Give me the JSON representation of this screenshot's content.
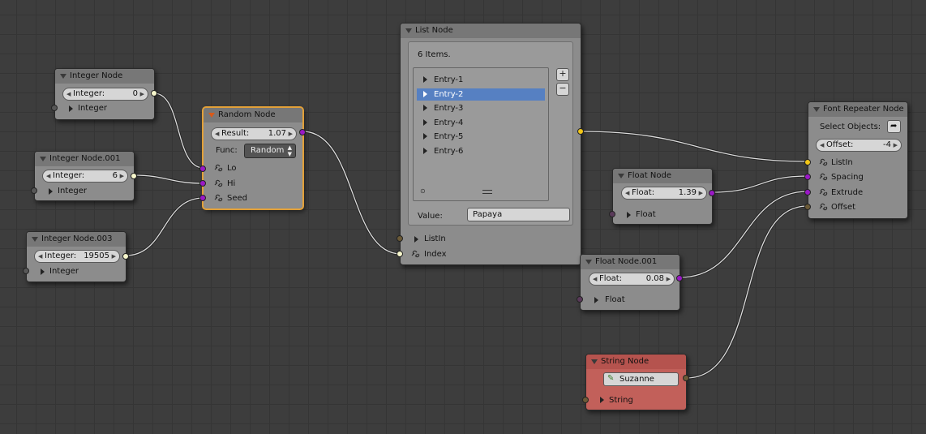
{
  "colors": {
    "background": "#3d3d3d",
    "node": "#8c8c8c",
    "node_header": "#777777",
    "selected_outline": "#e2a038",
    "list_selection": "#5680c2",
    "string_node": "#c2605a"
  },
  "integer_node": {
    "title": "Integer Node",
    "field_label": "Integer:",
    "field_value": "0",
    "output": "Integer"
  },
  "integer_node_001": {
    "title": "Integer Node.001",
    "field_label": "Integer:",
    "field_value": "6",
    "output": "Integer"
  },
  "integer_node_003": {
    "title": "Integer Node.003",
    "field_label": "Integer:",
    "field_value": "19505",
    "output": "Integer"
  },
  "random_node": {
    "title": "Random Node",
    "result_label": "Result:",
    "result_value": "1.07",
    "func_label": "Func:",
    "func_value": "Random",
    "inputs": [
      "Lo",
      "Hi",
      "Seed"
    ]
  },
  "list_node": {
    "title": "List Node",
    "count_text": "6 Items.",
    "entries": [
      "Entry-1",
      "Entry-2",
      "Entry-3",
      "Entry-4",
      "Entry-5",
      "Entry-6"
    ],
    "selected_entry": "Entry-2",
    "value_label": "Value:",
    "value": "Papaya",
    "inputs": [
      "ListIn",
      "Index"
    ],
    "add_icon": "+",
    "remove_icon": "−"
  },
  "float_node": {
    "title": "Float Node",
    "field_label": "Float:",
    "field_value": "1.39",
    "output": "Float"
  },
  "float_node_001": {
    "title": "Float Node.001",
    "field_label": "Float:",
    "field_value": "0.08",
    "output": "Float"
  },
  "font_repeater_node": {
    "title": "Font Repeater Node",
    "select_label": "Select Objects:",
    "offset_label": "Offset:",
    "offset_value": "-4",
    "inputs": [
      "ListIn",
      "Spacing",
      "Extrude",
      "Offset"
    ]
  },
  "string_node": {
    "title": "String Node",
    "value": "Suzanne",
    "output": "String"
  }
}
